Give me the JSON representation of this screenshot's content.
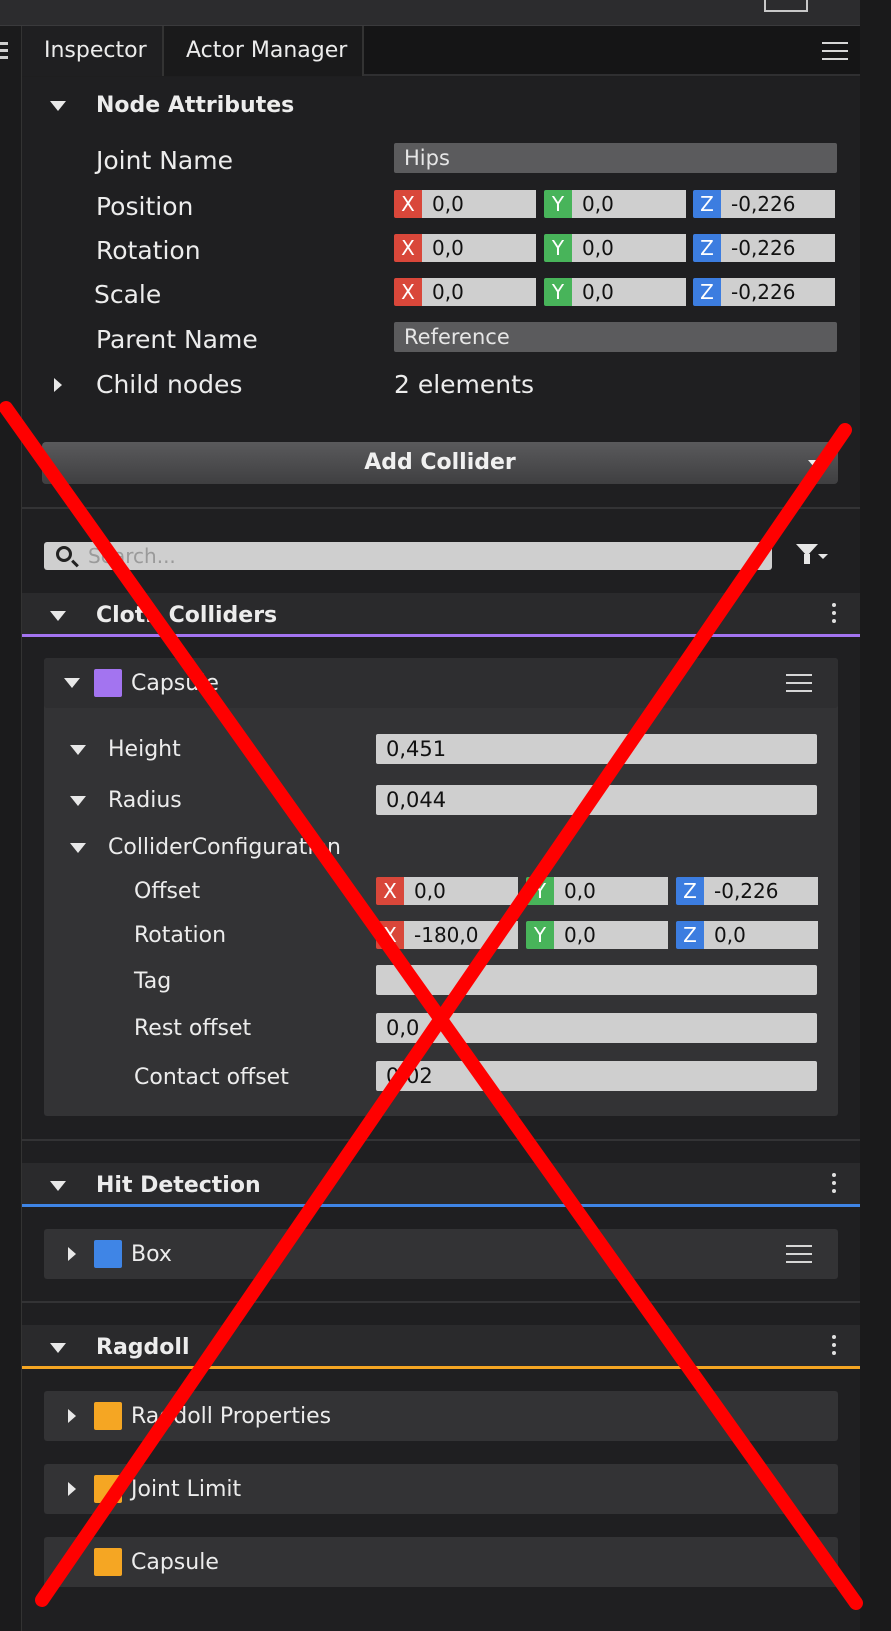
{
  "tabs": [
    {
      "label": "Inspector"
    },
    {
      "label": "Actor Manager"
    }
  ],
  "node_attributes": {
    "title": "Node Attributes",
    "joint_name_label": "Joint Name",
    "joint_name_value": "Hips",
    "position_label": "Position",
    "position": {
      "x": "0,0",
      "y": "0,0",
      "z": "-0,226"
    },
    "rotation_label": "Rotation",
    "rotation": {
      "x": "0,0",
      "y": "0,0",
      "z": "-0,226"
    },
    "scale_label": "Scale",
    "scale": {
      "x": "0,0",
      "y": "0,0",
      "z": "-0,226"
    },
    "parent_name_label": "Parent Name",
    "parent_name_value": "Reference",
    "child_nodes_label": "Child nodes",
    "child_nodes_value": "2 elements"
  },
  "axis_labels": {
    "x": "X",
    "y": "Y",
    "z": "Z"
  },
  "add_collider_label": "Add Collider",
  "search": {
    "placeholder": "Search..."
  },
  "sections": {
    "cloth": {
      "title": "Cloth Colliders",
      "color": "#a374f0"
    },
    "hit": {
      "title": "Hit Detection",
      "color": "#3f85e6"
    },
    "ragdoll": {
      "title": "Ragdoll",
      "color": "#f5a623"
    }
  },
  "capsule_card": {
    "title": "Capsule",
    "height_label": "Height",
    "height_value": "0,451",
    "radius_label": "Radius",
    "radius_value": "0,044",
    "config_label": "ColliderConfiguration",
    "offset_label": "Offset",
    "offset": {
      "x": "0,0",
      "y": "0,0",
      "z": "-0,226"
    },
    "rotation_label": "Rotation",
    "rotation": {
      "x": "-180,0",
      "y": "0,0",
      "z": "0,0"
    },
    "tag_label": "Tag",
    "tag_value": "",
    "rest_offset_label": "Rest offset",
    "rest_offset_value": "0,0",
    "contact_offset_label": "Contact offset",
    "contact_offset_value": "0,02"
  },
  "hit_card": {
    "title": "Box"
  },
  "ragdoll_cards": [
    {
      "title": "Ragdoll Properties"
    },
    {
      "title": "Joint Limit"
    },
    {
      "title": "Capsule"
    }
  ]
}
